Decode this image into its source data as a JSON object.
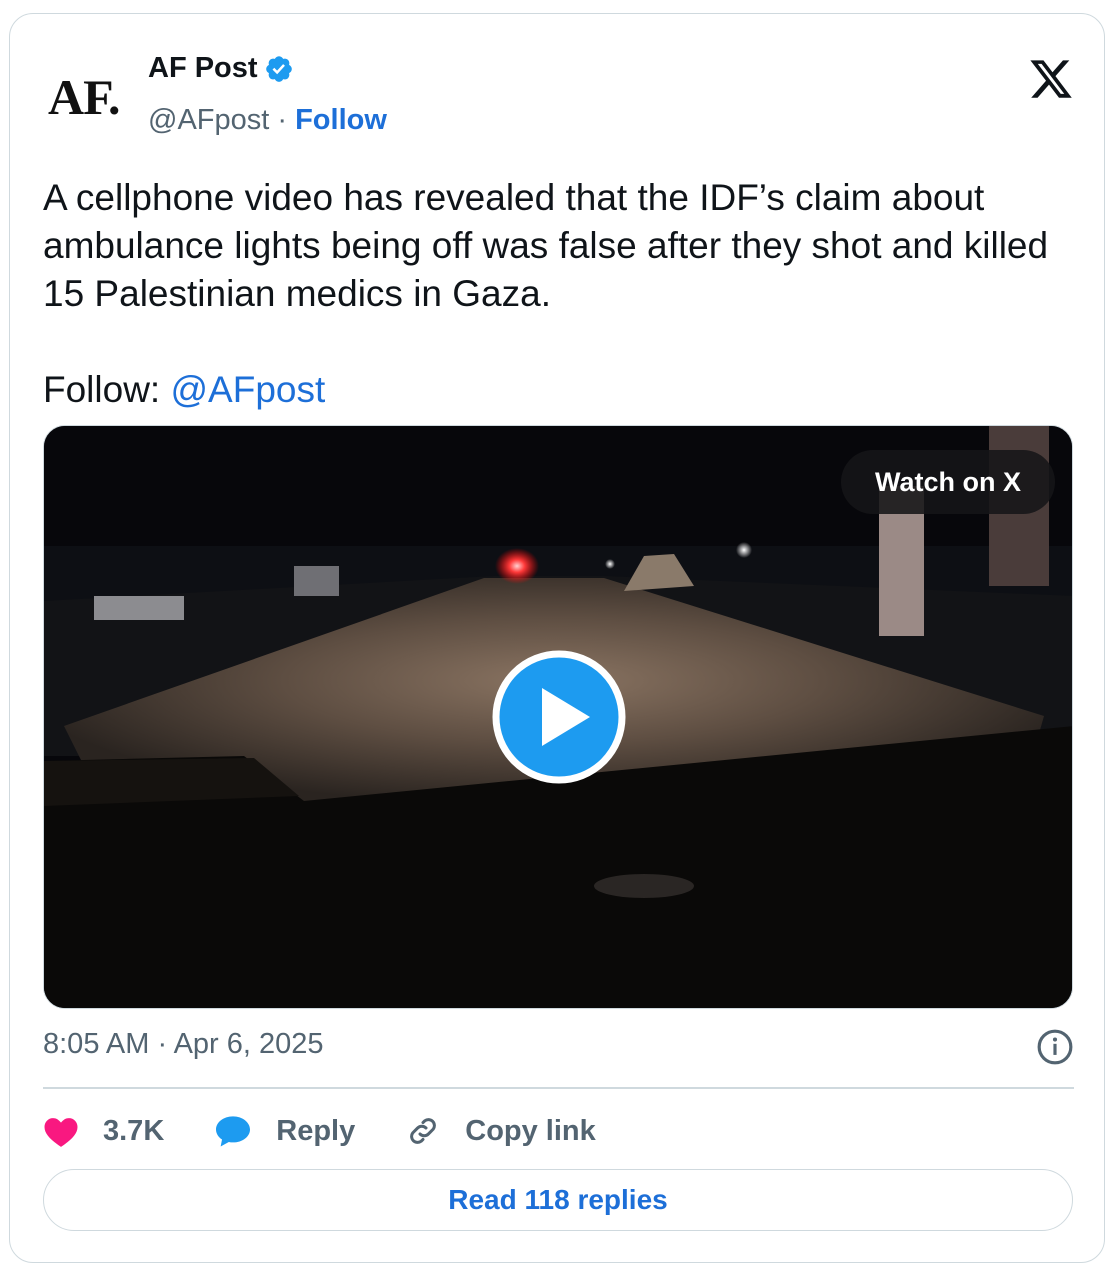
{
  "author": {
    "logo_text": "AF.",
    "name": "AF Post",
    "handle": "@AFpost",
    "separator": " · ",
    "follow_label": "Follow"
  },
  "tweet": {
    "body": "A cellphone video has revealed that the IDF’s claim about ambulance lights being off was false after they shot and killed 15 Palestinian medics in Gaza.",
    "follow_prefix": "Follow: ",
    "follow_mention": "@AFpost"
  },
  "media": {
    "watch_label": "Watch on X"
  },
  "timestamp": "8:05 AM · Apr 6, 2025",
  "actions": {
    "likes_count": "3.7K",
    "reply_label": "Reply",
    "copy_link_label": "Copy link"
  },
  "read_replies_label": "Read 118 replies",
  "colors": {
    "accent": "#1d6fd8",
    "like": "#f91880",
    "reply_icon": "#1d9bf0",
    "muted": "#536471",
    "border": "#cfd9de",
    "play_button": "#1d9bf0"
  }
}
